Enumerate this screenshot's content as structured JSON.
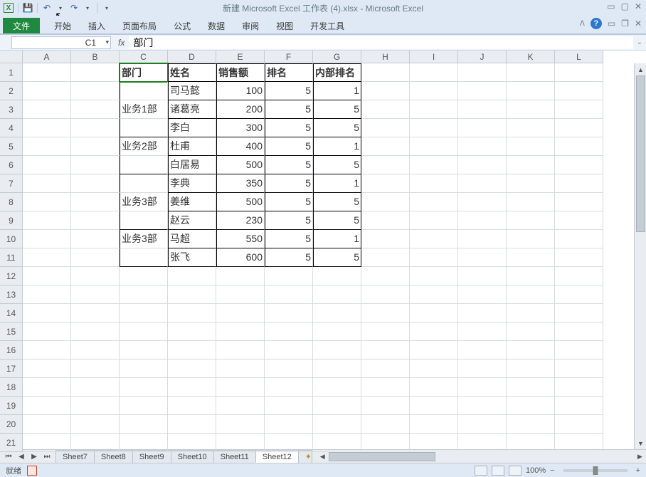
{
  "title": "新建 Microsoft Excel 工作表 (4).xlsx  -  Microsoft Excel",
  "qat": {
    "undo": "↶",
    "redo": "↷"
  },
  "ribbon": {
    "file": "文件",
    "tabs": [
      "开始",
      "插入",
      "页面布局",
      "公式",
      "数据",
      "审阅",
      "视图",
      "开发工具"
    ]
  },
  "nameBox": "C1",
  "formula": "部门",
  "columns": [
    "A",
    "B",
    "C",
    "D",
    "E",
    "F",
    "G",
    "H",
    "I",
    "J",
    "K",
    "L"
  ],
  "rowCount": 21,
  "headerRow": {
    "c": "部门",
    "d": "姓名",
    "e": "销售额",
    "f": "排名",
    "g": "内部排名"
  },
  "dataRows": [
    {
      "c": "",
      "d": "司马懿",
      "e": "100",
      "f": "5",
      "g": "1"
    },
    {
      "c": "业务1部",
      "d": "诸葛亮",
      "e": "200",
      "f": "5",
      "g": "5"
    },
    {
      "c": "",
      "d": "李白",
      "e": "300",
      "f": "5",
      "g": "5"
    },
    {
      "c": "业务2部",
      "d": "杜甫",
      "e": "400",
      "f": "5",
      "g": "1"
    },
    {
      "c": "",
      "d": "白居易",
      "e": "500",
      "f": "5",
      "g": "5"
    },
    {
      "c": "",
      "d": "李典",
      "e": "350",
      "f": "5",
      "g": "1"
    },
    {
      "c": "业务3部",
      "d": "姜维",
      "e": "500",
      "f": "5",
      "g": "5"
    },
    {
      "c": "",
      "d": "赵云",
      "e": "230",
      "f": "5",
      "g": "5"
    },
    {
      "c": "业务3部",
      "d": "马超",
      "e": "550",
      "f": "5",
      "g": "1"
    },
    {
      "c": "",
      "d": "张飞",
      "e": "600",
      "f": "5",
      "g": "5"
    }
  ],
  "sheets": [
    "Sheet7",
    "Sheet8",
    "Sheet9",
    "Sheet10",
    "Sheet11",
    "Sheet12"
  ],
  "activeSheet": 5,
  "status": {
    "ready": "就绪",
    "zoom": "100%"
  }
}
